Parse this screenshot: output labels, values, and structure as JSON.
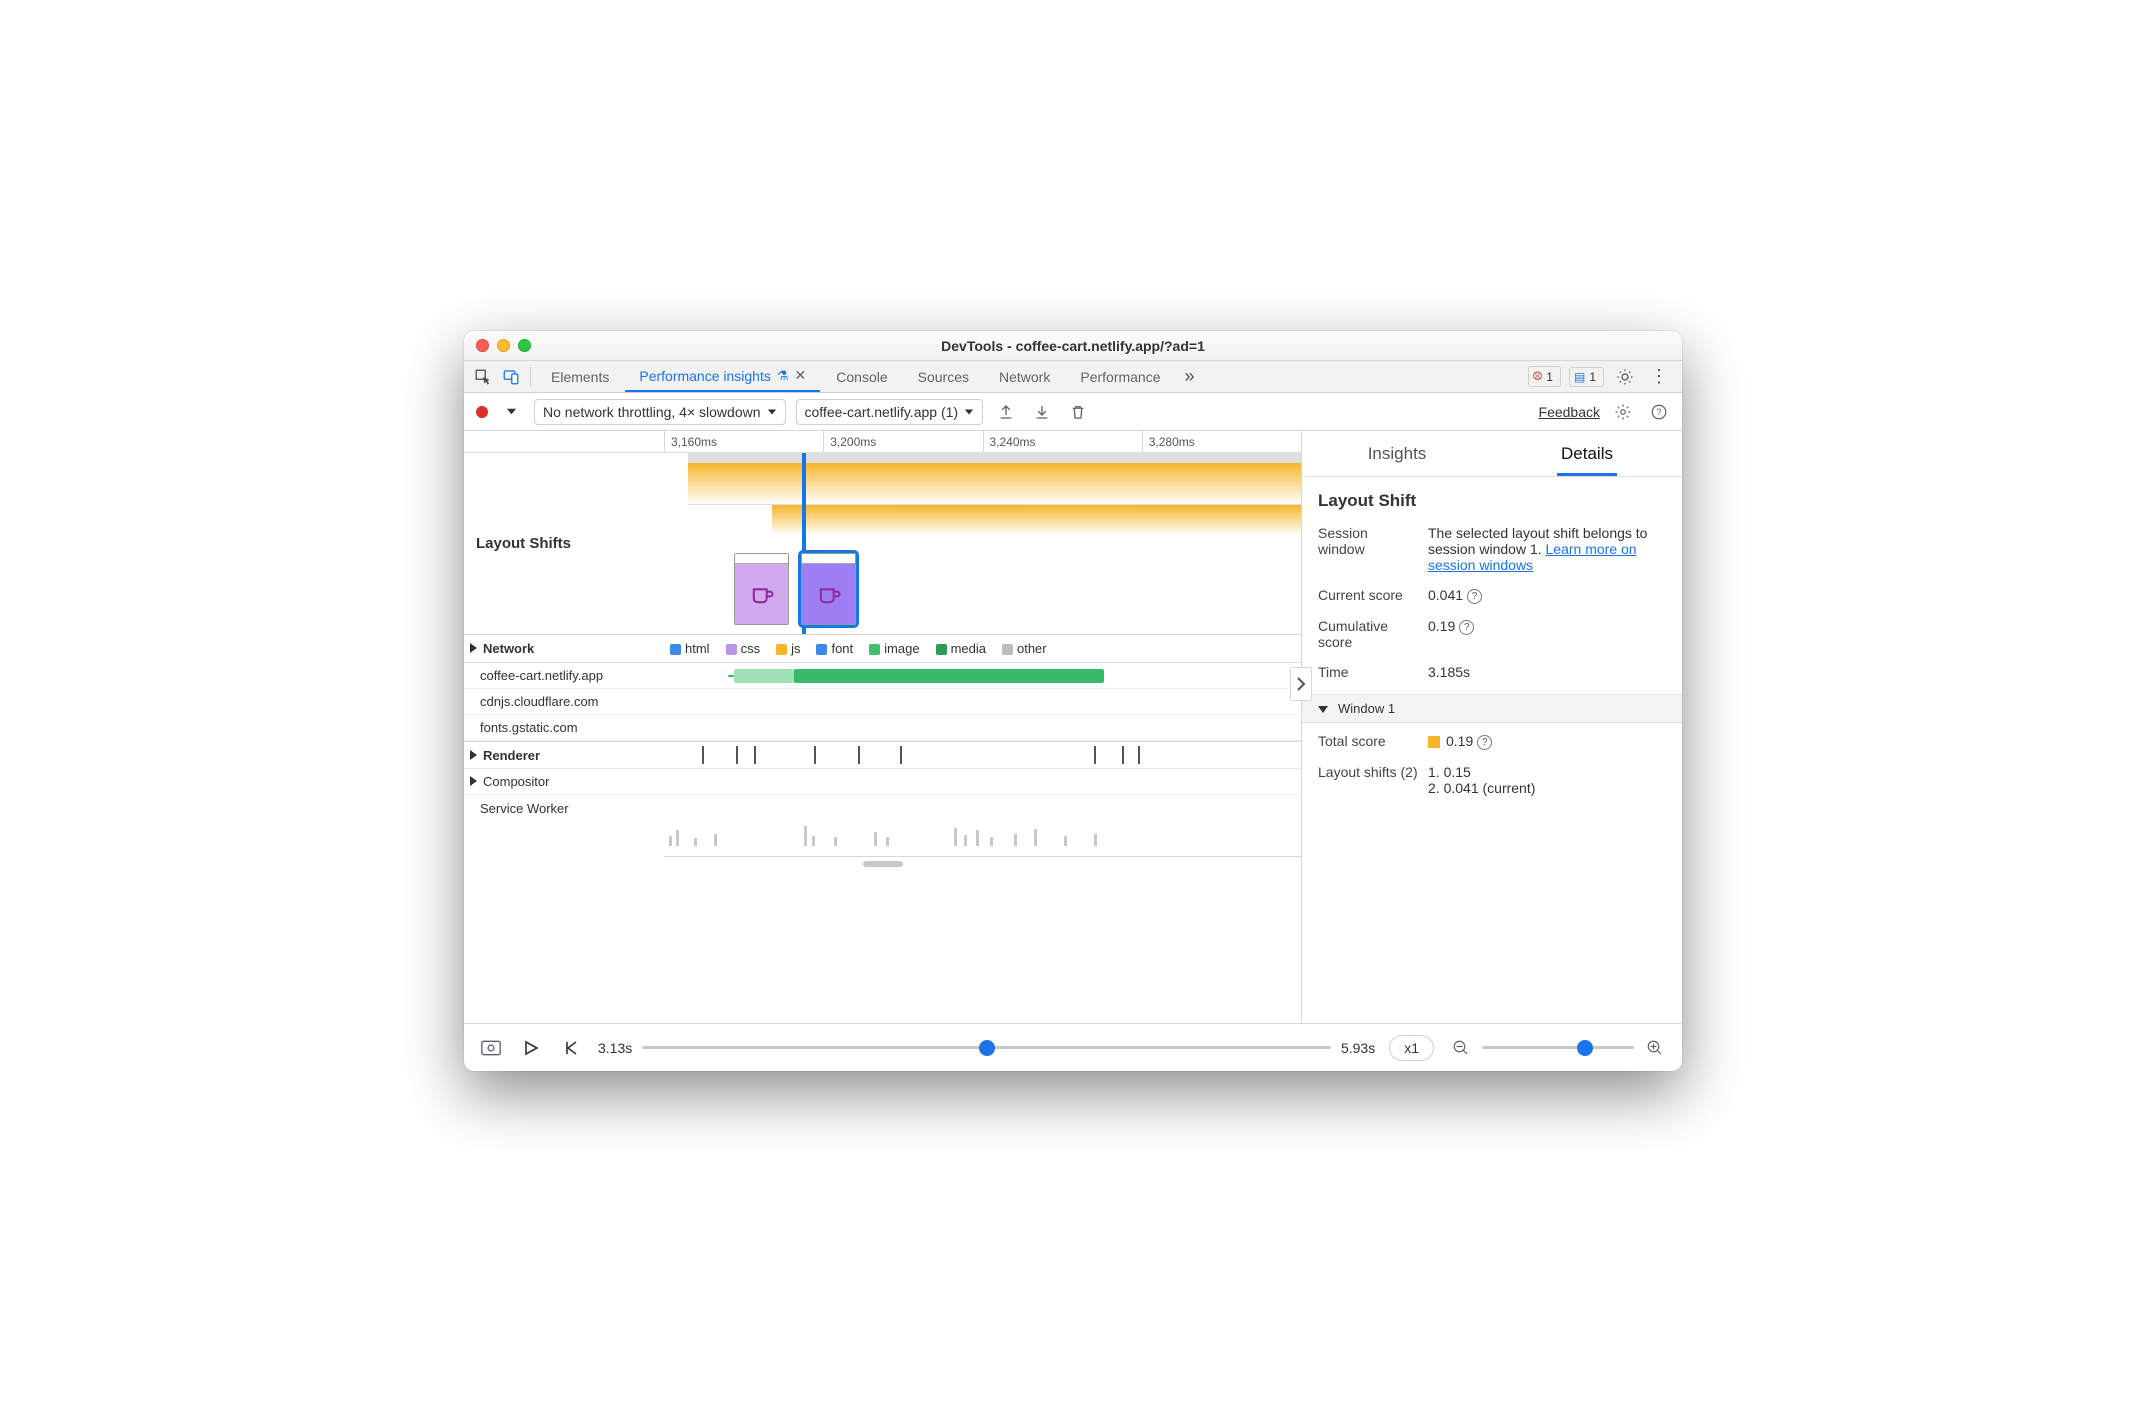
{
  "window": {
    "title_bold": "DevTools",
    "title_rest": "- coffee-cart.netlify.app/?ad=1"
  },
  "tabs": {
    "items": [
      "Elements",
      "Performance insights",
      "Console",
      "Sources",
      "Network",
      "Performance"
    ],
    "active_index": 1,
    "overflow_glyph": "»",
    "errors_count": "1",
    "messages_count": "1"
  },
  "toolbar": {
    "throttle_label": "No network throttling, 4× slowdown",
    "capture_label": "coffee-cart.netlify.app (1)",
    "feedback_label": "Feedback"
  },
  "ruler": {
    "ticks": [
      "3,160ms",
      "3,200ms",
      "3,240ms",
      "3,280ms"
    ]
  },
  "layout_shifts": {
    "label": "Layout Shifts"
  },
  "network": {
    "label": "Network",
    "legend": [
      "html",
      "css",
      "js",
      "font",
      "image",
      "media",
      "other"
    ],
    "legend_colors": [
      "#3f88e8",
      "#b894e7",
      "#f5b62b",
      "#3f88e8",
      "#3cbf6e",
      "#2a9d55",
      "#bdbdbd"
    ],
    "hosts": [
      "coffee-cart.netlify.app",
      "cdnjs.cloudflare.com",
      "fonts.gstatic.com"
    ]
  },
  "renderer": {
    "label": "Renderer",
    "compositor": "Compositor",
    "service_worker": "Service Worker"
  },
  "side": {
    "tabs": [
      "Insights",
      "Details"
    ],
    "active": 1,
    "heading": "Layout Shift",
    "session_window_label": "Session window",
    "session_window_text_pre": "The selected layout shift belongs to session window 1. ",
    "session_window_link": "Learn more on session windows",
    "current_score_label": "Current score",
    "current_score_value": "0.041",
    "cumulative_score_label": "Cumulative score",
    "cumulative_score_value": "0.19",
    "time_label": "Time",
    "time_value": "3.185s",
    "window_header": "Window 1",
    "total_score_label": "Total score",
    "total_score_value": "0.19",
    "layout_shifts_label": "Layout shifts (2)",
    "layout_shifts_items": [
      "1. 0.15",
      "2. 0.041 (current)"
    ]
  },
  "bottom": {
    "start": "3.13s",
    "end": "5.93s",
    "speed": "x1"
  }
}
